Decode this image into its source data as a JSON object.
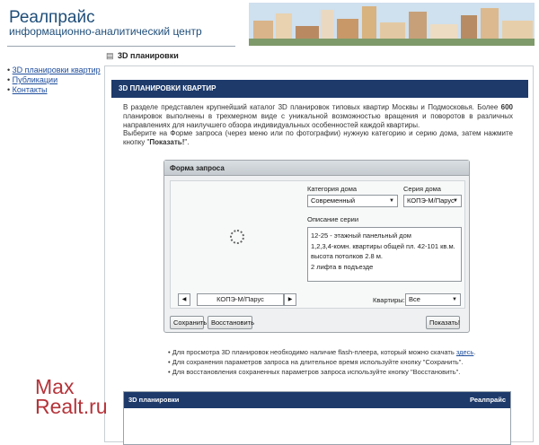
{
  "header": {
    "title": "Реалпрайс",
    "subtitle": "информационно-аналитический центр"
  },
  "breadcrumb": {
    "label": "3D планировки"
  },
  "sidebar": {
    "items": [
      {
        "label": "3D планировки квартир"
      },
      {
        "label": "Публикации"
      },
      {
        "label": "Контакты"
      }
    ]
  },
  "main": {
    "title": "3D ПЛАНИРОВКИ КВАРТИР",
    "intro1_a": "В разделе представлен крупнейший каталог 3D планировок типовых квартир Москвы и Подмосковья. Более ",
    "intro1_bold": "600",
    "intro1_b": " планировок выполнены в трехмерном виде с уникальной возможностью вращения и поворотов в различных направлениях для наилучшего обзора индивидуальных особенностей каждой квартиры.",
    "intro2_a": "Выберите на Форме запроса (через меню или по фотографии) нужную категорию и серию дома, затем нажмите кнопку \"",
    "intro2_bold": "Показать!",
    "intro2_b": "\"."
  },
  "form": {
    "title": "Форма запроса",
    "category_label": "Категория дома",
    "category_value": "Современный",
    "series_label": "Серия дома",
    "series_value": "КОПЭ-М/Парус",
    "description_label": "Описание серии",
    "description_lines": [
      "12-25 - этажный панельный дом",
      "1,2,3,4-комн. квартиры общей пл. 42-101 кв.м.",
      "высота потолков 2.8 м.",
      "2 лифта в подъезде"
    ],
    "current_series": "КОПЭ-М/Парус",
    "prev_glyph": "◀",
    "next_glyph": "▶",
    "apartments_label": "Квартиры:",
    "apartments_value": "Все",
    "save_label": "Сохранить",
    "restore_label": "Восстановить",
    "show_label": "Показать!",
    "dropdown_glyph": "▼"
  },
  "tips": {
    "flash_a": "Для просмотра 3D планировок необходимо наличие flash-плеера, который можно скачать ",
    "flash_link": "здесь",
    "flash_b": ".",
    "save_tip": "Для сохранения параметров запроса на длительное время используйте кнопку \"Сохранить\".",
    "restore_tip": "Для восстановления сохраненных параметров запроса используйте кнопку \"Восстановить\"."
  },
  "viewer": {
    "title": "3D планировки",
    "brand": "Реалпрайс"
  },
  "watermark": {
    "line1": "Max",
    "line2": "Realt.ru"
  },
  "colors": {
    "brand_blue": "#1f4e79",
    "panel_header": "#1d3a6b",
    "link": "#1f4e9c",
    "watermark": "#b5343a"
  }
}
